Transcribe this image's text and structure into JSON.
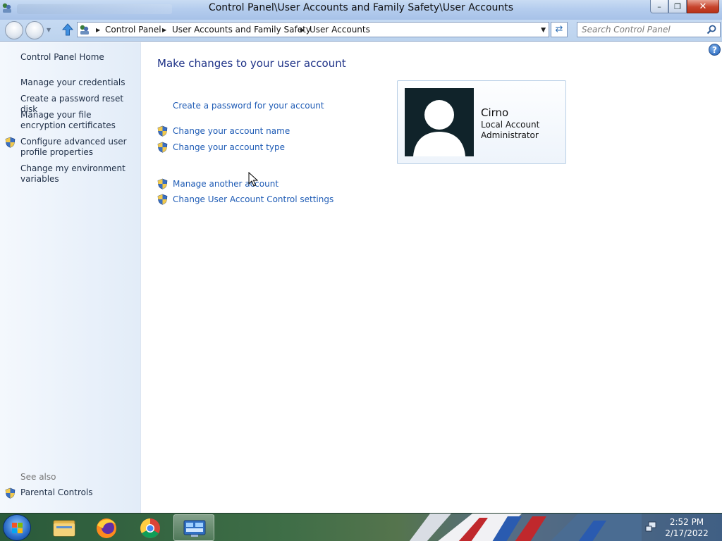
{
  "window": {
    "title": "Control Panel\\User Accounts and Family Safety\\User Accounts",
    "minimize_label": "–",
    "restore_label": "❐",
    "close_label": "✕"
  },
  "address_bar": {
    "breadcrumbs": [
      "Control Panel",
      "User Accounts and Family Safety",
      "User Accounts"
    ]
  },
  "search": {
    "placeholder": "Search Control Panel"
  },
  "sidebar": {
    "home": "Control Panel Home",
    "items": [
      {
        "label": "Manage your credentials",
        "shield": false
      },
      {
        "label": "Create a password reset disk",
        "shield": false
      },
      {
        "label": "Manage your file encryption certificates",
        "shield": false
      },
      {
        "label": "Configure advanced user profile properties",
        "shield": true
      },
      {
        "label": "Change my environment variables",
        "shield": false
      }
    ],
    "see_also_label": "See also",
    "see_also_items": [
      {
        "label": "Parental Controls",
        "shield": true
      }
    ]
  },
  "main": {
    "heading": "Make changes to your user account",
    "tasks": [
      {
        "label": "Create a password for your account",
        "shield": false
      },
      {
        "label": "Change your account name",
        "shield": true
      },
      {
        "label": "Change your account type",
        "shield": true
      },
      {
        "label": "Manage another account",
        "shield": true
      },
      {
        "label": "Change User Account Control settings",
        "shield": true
      }
    ],
    "help_label": "?"
  },
  "user_card": {
    "name": "Cirno",
    "account_type": "Local Account",
    "role": "Administrator"
  },
  "taskbar": {
    "pinned": [
      "start-orb",
      "file-explorer",
      "firefox",
      "chrome",
      "control-panel"
    ],
    "active": "control-panel",
    "clock": {
      "time": "2:52 PM",
      "date": "2/17/2022"
    }
  },
  "colors": {
    "link": "#1e5bb5",
    "heading": "#1e3287",
    "sidebar_bg": "#e2ecf8",
    "titlebar": "#b5cdee"
  }
}
